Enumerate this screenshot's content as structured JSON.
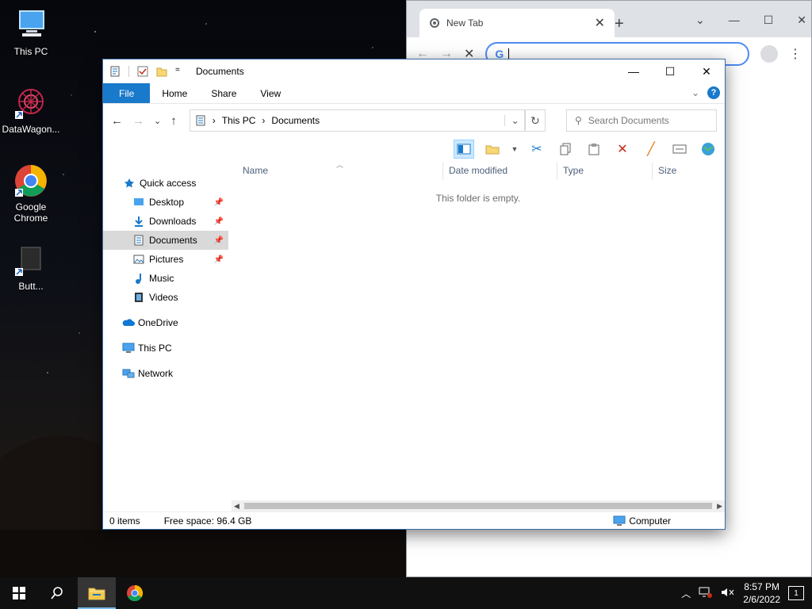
{
  "desktop": {
    "icons": [
      {
        "label": "This PC",
        "icon": "monitor-icon"
      },
      {
        "label": "DataWagon...",
        "icon": "datawagon-icon"
      },
      {
        "label": "Google Chrome",
        "icon": "chrome-icon"
      },
      {
        "label": "Butt...",
        "icon": "shortcut-icon"
      }
    ]
  },
  "chrome": {
    "tab_title": "New Tab",
    "tab_close": "✕",
    "new_tab": "+",
    "caption_chevron": "⌄",
    "caption_minimize": "—",
    "caption_maximize": "☐",
    "caption_close": "✕",
    "back": "←",
    "forward": "→",
    "stop": "✕",
    "google_g": "G",
    "menu": "⋮"
  },
  "explorer": {
    "window_title": "Documents",
    "caption_minimize": "—",
    "caption_maximize": "☐",
    "caption_close": "✕",
    "tabs": {
      "file": "File",
      "home": "Home",
      "share": "Share",
      "view": "View"
    },
    "ribbon_expand": "⌄",
    "help": "?",
    "nav": {
      "back": "←",
      "forward": "→",
      "recent": "⌄",
      "up": "↑"
    },
    "breadcrumb": [
      "This PC",
      "Documents"
    ],
    "breadcrumb_separator": "›",
    "address_dropdown": "⌄",
    "refresh": "↻",
    "search_placeholder": "Search Documents",
    "search_icon": "⚲",
    "columns": [
      "Name",
      "Date modified",
      "Type",
      "Size"
    ],
    "empty_message": "This folder is empty.",
    "nav_pane": [
      {
        "label": "Quick access",
        "icon": "star-icon",
        "pinned": false
      },
      {
        "label": "Desktop",
        "icon": "desktop-folder-icon",
        "pinned": true
      },
      {
        "label": "Downloads",
        "icon": "downloads-icon",
        "pinned": true
      },
      {
        "label": "Documents",
        "icon": "documents-icon",
        "pinned": true
      },
      {
        "label": "Pictures",
        "icon": "pictures-icon",
        "pinned": true
      },
      {
        "label": "Music",
        "icon": "music-icon",
        "pinned": false
      },
      {
        "label": "Videos",
        "icon": "videos-icon",
        "pinned": false
      },
      {
        "label": "OneDrive",
        "icon": "onedrive-icon",
        "pinned": false
      },
      {
        "label": "This PC",
        "icon": "this-pc-icon",
        "pinned": false
      },
      {
        "label": "Network",
        "icon": "network-icon",
        "pinned": false
      }
    ],
    "pin_glyph": "📌",
    "status_left": "0 items",
    "status_free_space": "Free space: 96.4 GB",
    "status_computer": "Computer"
  },
  "taskbar": {
    "time": "8:57 PM",
    "date": "2/6/2022",
    "notifications": "1",
    "tray_chevron": "︿"
  },
  "colors": {
    "accent": "#1979ca",
    "taskbar": "#101010"
  }
}
